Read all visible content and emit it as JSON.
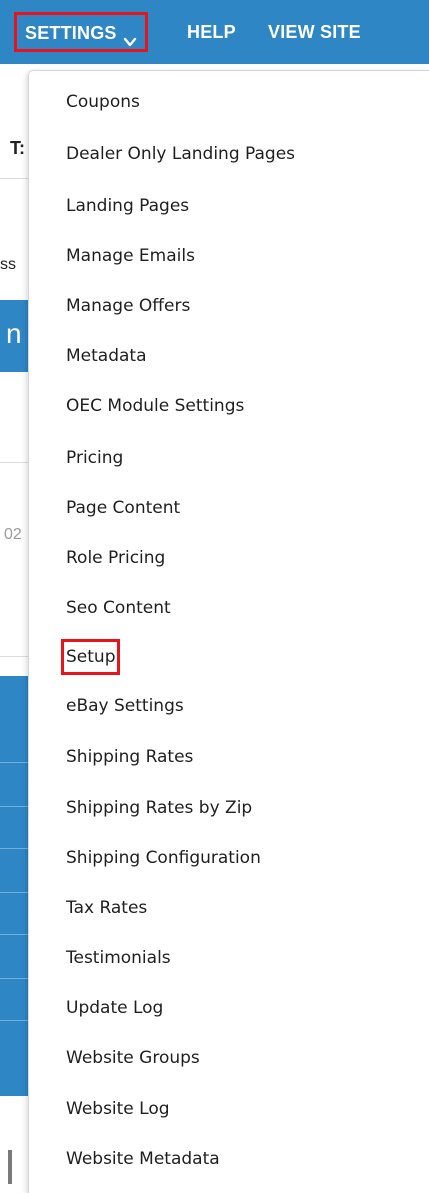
{
  "topnav": {
    "settings_label": "SETTINGS",
    "help_label": "HELP",
    "view_site_label": "VIEW SITE",
    "settings_icon": "chevron-down-icon",
    "bar_color": "#2f86c5",
    "highlight_color": "#e8141b"
  },
  "background": {
    "fragments": [
      "T:",
      "ss",
      "n",
      "02"
    ]
  },
  "menu": {
    "items": [
      {
        "label": "Coupons"
      },
      {
        "label": "Dealer Only Landing Pages"
      },
      {
        "label": "Landing Pages"
      },
      {
        "label": "Manage Emails"
      },
      {
        "label": "Manage Offers"
      },
      {
        "label": "Metadata"
      },
      {
        "label": "OEC Module Settings"
      },
      {
        "label": "Pricing"
      },
      {
        "label": "Page Content"
      },
      {
        "label": "Role Pricing"
      },
      {
        "label": "Seo Content"
      },
      {
        "label": "Setup",
        "highlighted": true
      },
      {
        "label": "eBay Settings"
      },
      {
        "label": "Shipping Rates"
      },
      {
        "label": "Shipping Rates by Zip"
      },
      {
        "label": "Shipping Configuration"
      },
      {
        "label": "Tax Rates"
      },
      {
        "label": "Testimonials"
      },
      {
        "label": "Update Log"
      },
      {
        "label": "Website Groups"
      },
      {
        "label": "Website Log"
      },
      {
        "label": "Website Metadata"
      }
    ]
  }
}
